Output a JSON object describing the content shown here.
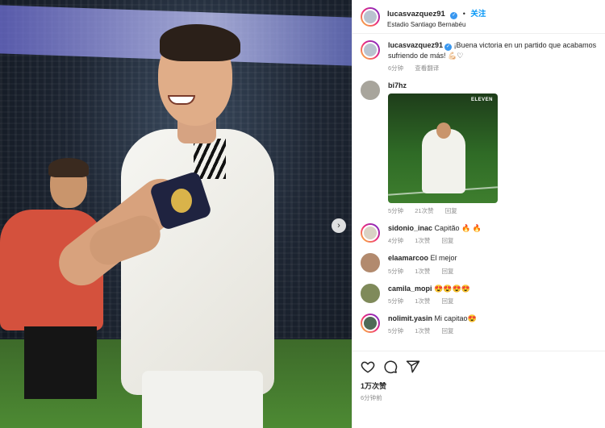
{
  "post": {
    "username": "lucasvazquez91",
    "follow_label": "关注",
    "dot": "•",
    "location": "Estadio Santiago Bernabéu"
  },
  "caption": {
    "username": "lucasvazquez91",
    "text": "¡Buena victoria en un partido que acabamos sufriendo de más! 💪🏻♡",
    "time": "6分钟",
    "translate_label": "查看翻译"
  },
  "comments": [
    {
      "username": "bi7hz",
      "text": "",
      "gif_tag": "ELEVEN",
      "time": "5分钟",
      "likes": "21次赞",
      "reply": "回复"
    },
    {
      "username": "sidonio_inac",
      "text": "Capitão 🔥 🔥",
      "time": "4分钟",
      "likes": "1次赞",
      "reply": "回复"
    },
    {
      "username": "elaamarcoo",
      "text": "El mejor",
      "time": "5分钟",
      "likes": "1次赞",
      "reply": "回复"
    },
    {
      "username": "camila_mopi",
      "text": "😍😍😍😍",
      "time": "5分钟",
      "likes": "1次赞",
      "reply": "回复"
    },
    {
      "username": "nolimit.yasin",
      "text": "Mi capitao😍",
      "time": "5分钟",
      "likes": "1次赞",
      "reply": "回复"
    }
  ],
  "footer": {
    "likes": "1万次赞",
    "ago": "6分钟前"
  },
  "icons": {
    "heart": "heart-icon",
    "comment": "comment-icon",
    "share": "share-icon",
    "next": "chevron-right-icon",
    "verified": "verified-badge-icon"
  },
  "colors": {
    "accent": "#0095f6",
    "verified": "#3897f0",
    "muted": "#8e8e8e"
  }
}
